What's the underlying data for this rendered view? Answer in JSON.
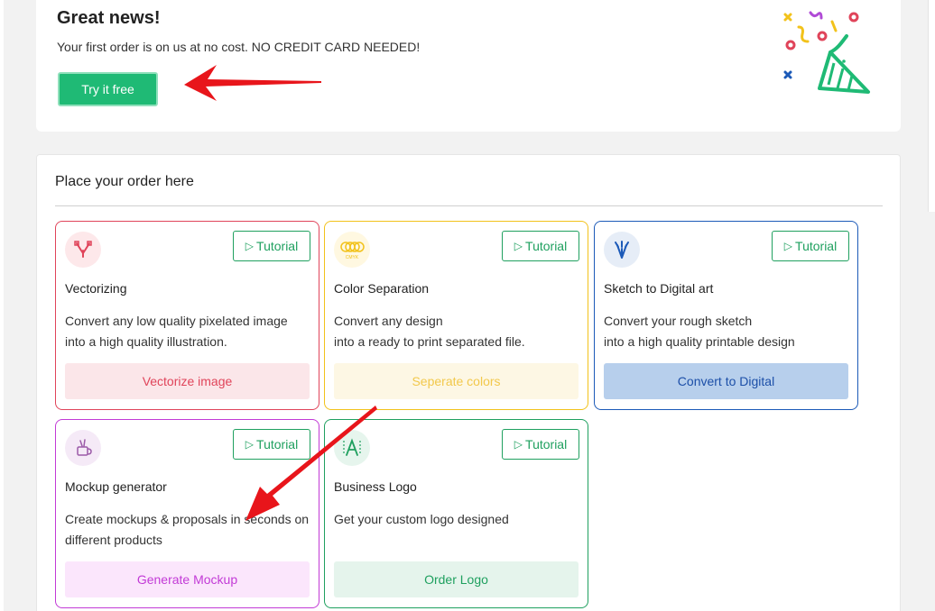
{
  "promo": {
    "title": "Great news!",
    "subtitle": "Your first order is on us at no cost. NO CREDIT CARD NEEDED!",
    "button_label": "Try it free",
    "illustration_icon": "party-popper-icon"
  },
  "order": {
    "title": "Place your order here",
    "cards": [
      {
        "icon": "vector-pen-icon",
        "tutorial_label": "Tutorial",
        "name": "Vectorizing",
        "desc_line1": "Convert any low quality pixelated image",
        "desc_line2": "into a high quality illustration.",
        "action_label": "Vectorize image",
        "border_color": "#e0445a",
        "action_bg": "#fbe6e9",
        "action_color": "#e0445a"
      },
      {
        "icon": "cmyk-circles-icon",
        "icon_text": "CMYK",
        "tutorial_label": "Tutorial",
        "name": "Color Separation",
        "desc_line1": "Convert any design",
        "desc_line2": "into a ready to print separated file.",
        "action_label": "Seperate colors",
        "border_color": "#f2c21b",
        "action_bg": "#fdf7e4",
        "action_color": "#f2c84b"
      },
      {
        "icon": "brushes-icon",
        "tutorial_label": "Tutorial",
        "name": "Sketch to Digital art",
        "desc_line1": "Convert your rough sketch",
        "desc_line2": "into a high quality printable design",
        "action_label": "Convert to Digital",
        "border_color": "#1c5ab8",
        "action_bg": "#b7cfec",
        "action_color": "#1c4fa8"
      },
      {
        "icon": "mockup-mug-icon",
        "tutorial_label": "Tutorial",
        "name": "Mockup generator",
        "desc_line1": "Create mockups & proposals in seconds on",
        "desc_line2": "different products",
        "action_label": "Generate Mockup",
        "border_color": "#c23ad6",
        "action_bg": "#fbe6fc",
        "action_color": "#c23ad6"
      },
      {
        "icon": "logo-design-icon",
        "tutorial_label": "Tutorial",
        "name": "Business Logo",
        "desc_line1": "Get your custom logo designed",
        "desc_line2": "",
        "action_label": "Order Logo",
        "border_color": "#1fa05f",
        "action_bg": "#e5f4ec",
        "action_color": "#1fa05f"
      }
    ]
  },
  "annotations": {
    "arrow_color": "#e8151b",
    "arrow1_icon": "red-arrow-icon",
    "arrow2_icon": "red-arrow-icon"
  }
}
